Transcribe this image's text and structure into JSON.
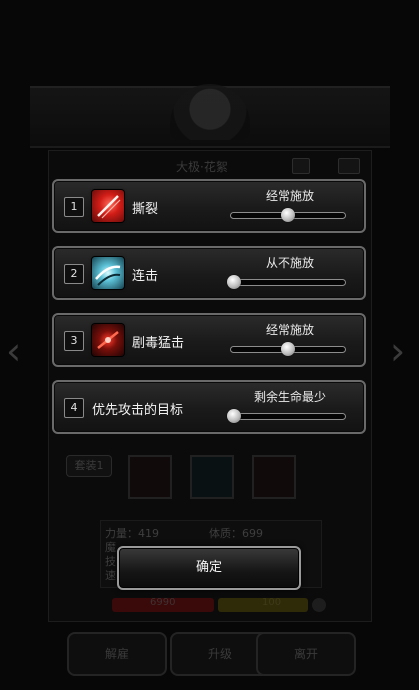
{
  "background": {
    "character_name": "大极·花絮",
    "gear_label": "套装1",
    "stats": {
      "strength": "力量：419",
      "constitution": "体质：699",
      "row2_prefix": "魔",
      "row3_prefix": "技",
      "row4_prefix": "速"
    },
    "hp_value": "6990",
    "mp_value": "100",
    "buttons": [
      "解雇",
      "升级",
      "离开"
    ]
  },
  "dialog": {
    "rows": [
      {
        "number": "1",
        "icon": "slash-skill-icon",
        "name": "撕裂",
        "option": "经常施放",
        "level": 0.5
      },
      {
        "number": "2",
        "icon": "combo-skill-icon",
        "name": "连击",
        "option": "从不施放",
        "level": 0.0
      },
      {
        "number": "3",
        "icon": "poison-strike-skill-icon",
        "name": "剧毒猛击",
        "option": "经常施放",
        "level": 0.5
      },
      {
        "number": "4",
        "icon": "",
        "name": "优先攻击的目标",
        "option": "剩余生命最少",
        "level": 0.0
      }
    ],
    "confirm_label": "确定"
  },
  "colors": {
    "row_border": "#6a6a6a",
    "hp_bar": "#7a1212",
    "mp_bar": "#6e6410"
  }
}
